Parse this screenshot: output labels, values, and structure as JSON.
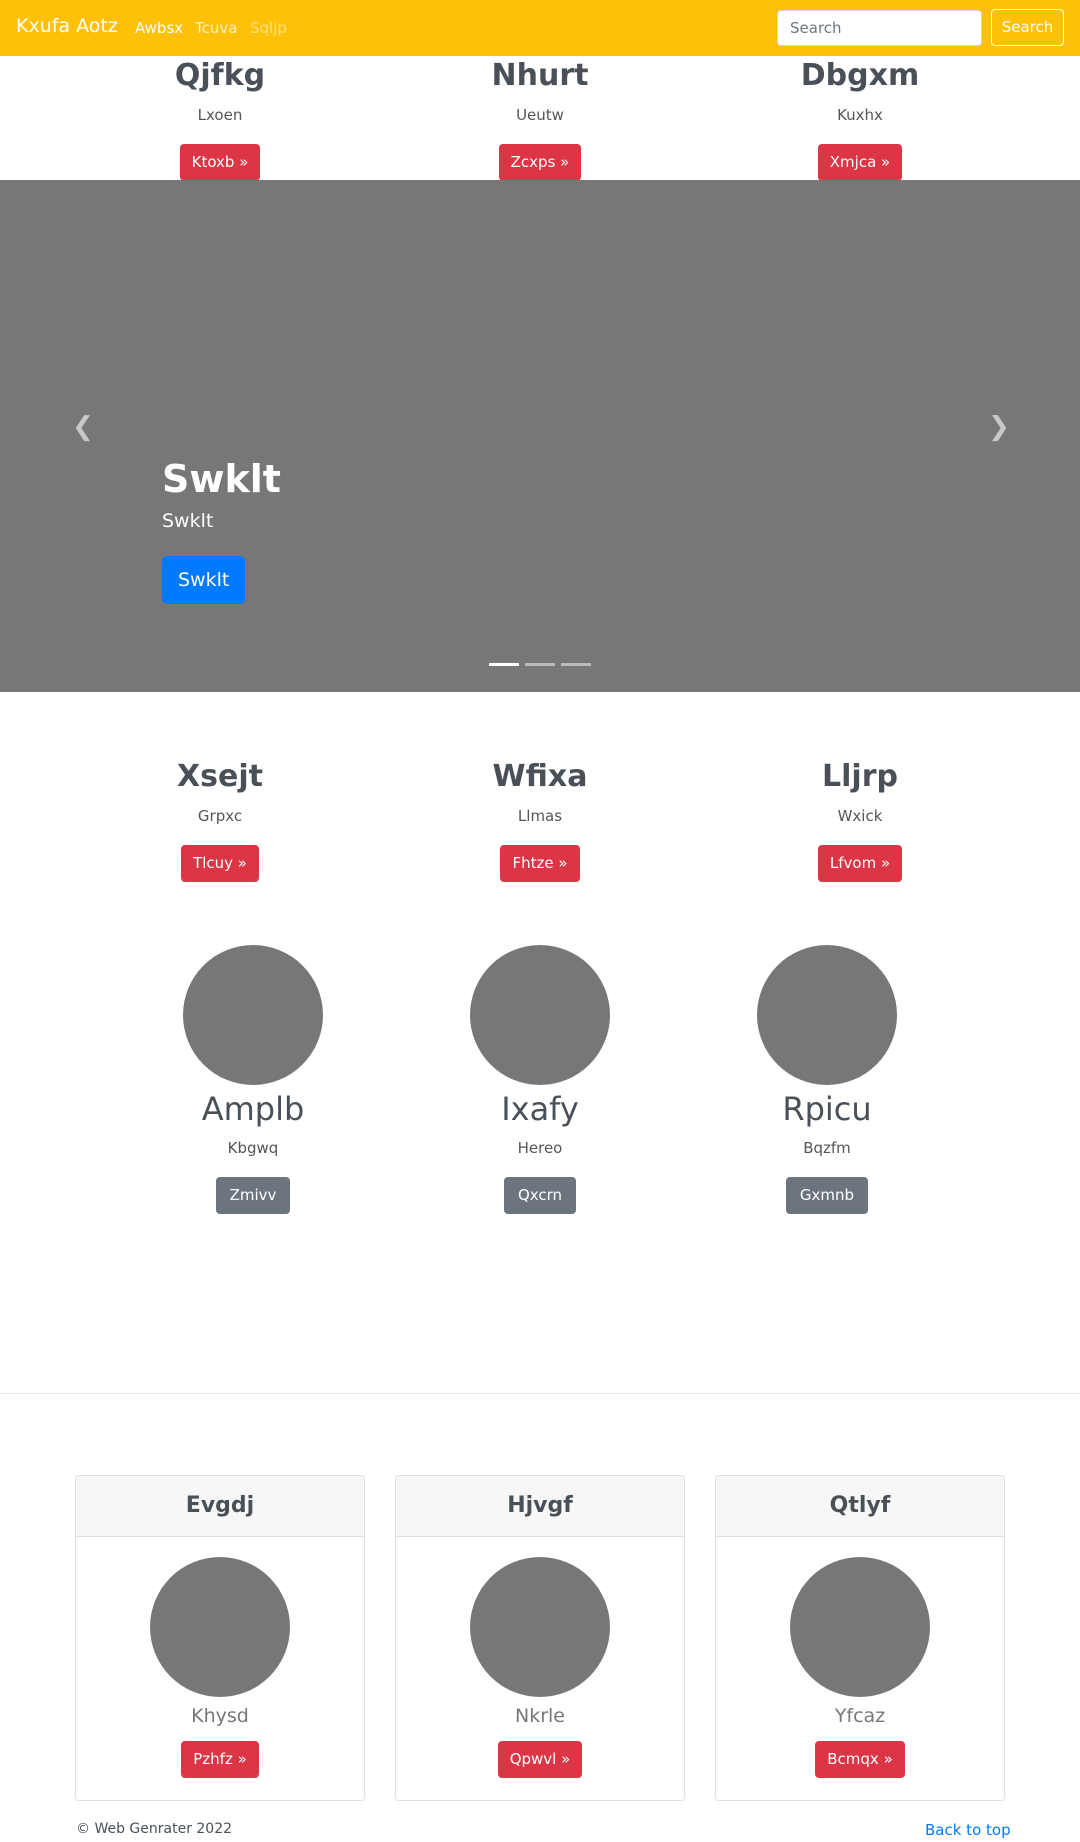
{
  "navbar": {
    "brand": "Kxufa Aotz",
    "links": [
      "Awbsx",
      "Tcuva",
      "Sqljp"
    ],
    "search_placeholder": "Search",
    "search_button": "Search"
  },
  "top_features": [
    {
      "title": "Qjfkg",
      "text": "Lxoen",
      "button": "Ktoxb »"
    },
    {
      "title": "Nhurt",
      "text": "Ueutw",
      "button": "Zcxps »"
    },
    {
      "title": "Dbgxm",
      "text": "Kuxhx",
      "button": "Xmjca »"
    }
  ],
  "carousel": {
    "title": "Swklt",
    "text": "Swklt",
    "button": "Swklt",
    "prev_icon": "chevron-left-icon",
    "next_icon": "chevron-right-icon",
    "slides": 3,
    "active_slide": 1
  },
  "mid_features": [
    {
      "title": "Xsejt",
      "text": "Grpxc",
      "button": "Tlcuy »"
    },
    {
      "title": "Wfixa",
      "text": "Llmas",
      "button": "Fhtze »"
    },
    {
      "title": "Lljrp",
      "text": "Wxick",
      "button": "Lfvom »"
    }
  ],
  "circle_features": [
    {
      "title": "Amplb",
      "text": "Kbgwq",
      "button": "Zmivv"
    },
    {
      "title": "Ixafy",
      "text": "Hereo",
      "button": "Qxcrn"
    },
    {
      "title": "Rpicu",
      "text": "Bqzfm",
      "button": "Gxmnb"
    }
  ],
  "cards": [
    {
      "header": "Evgdj",
      "text": "Khysd",
      "button": "Pzhfz »"
    },
    {
      "header": "Hjvgf",
      "text": "Nkrle",
      "button": "Qpwvl »"
    },
    {
      "header": "Qtlyf",
      "text": "Yfcaz",
      "button": "Bcmqx »"
    }
  ],
  "footer": {
    "copyright": "© Web Genrater 2022",
    "back_to_top": "Back to top"
  },
  "colors": {
    "navbar": "#ffc107",
    "danger": "#dc3545",
    "primary": "#007bff",
    "secondary": "#6c757d",
    "placeholder": "#777777"
  }
}
